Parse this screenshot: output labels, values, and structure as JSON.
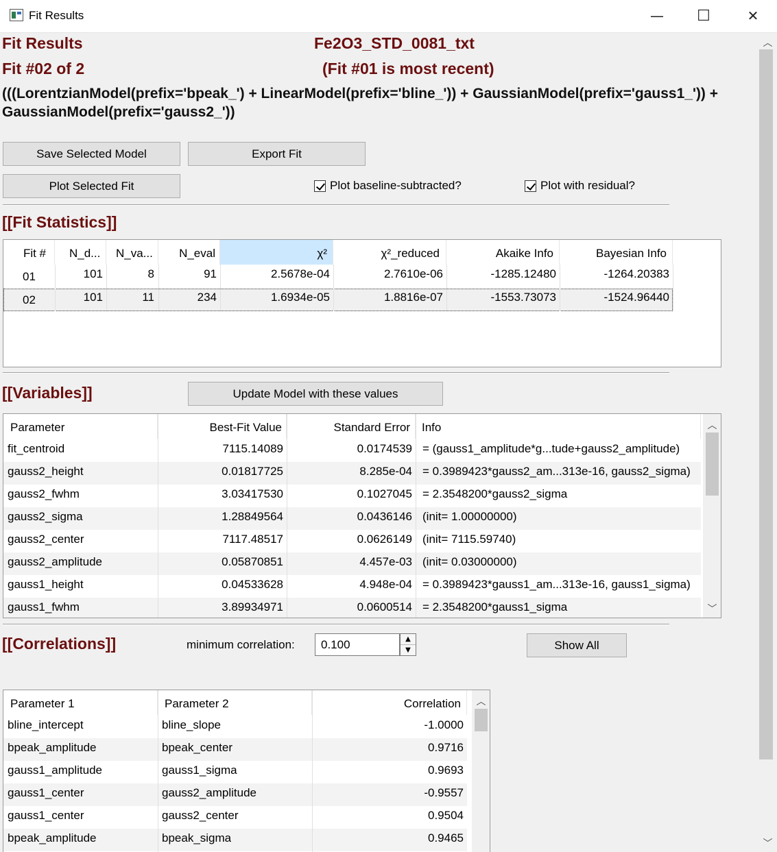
{
  "window": {
    "title": "Fit Results",
    "min_glyph": "—",
    "max_glyph": "☐",
    "close_glyph": "✕"
  },
  "header": {
    "label": "Fit Results",
    "filename": "Fe2O3_STD_0081_txt",
    "fit_index": "Fit #02 of 2",
    "recent_note": "(Fit #01 is most recent)",
    "model_line1": "(((LorentzianModel(prefix='bpeak_') + LinearModel(prefix='bline_')) + GaussianModel(prefix='gauss1_')) +",
    "model_line2": " GaussianModel(prefix='gauss2_'))"
  },
  "buttons": {
    "save_model": "Save Selected Model",
    "export_fit": "Export Fit",
    "plot_fit": "Plot Selected Fit",
    "update_model": "Update Model with these values",
    "show_all": "Show All"
  },
  "checkboxes": {
    "baseline": {
      "label": "Plot baseline-subtracted?",
      "checked": true
    },
    "residual": {
      "label": "Plot with residual?",
      "checked": true
    }
  },
  "stats": {
    "title": "[[Fit Statistics]]",
    "columns": [
      "Fit #",
      "N_d...",
      "N_va...",
      "N_eval",
      "χ²",
      "χ²_reduced",
      "Akaike Info",
      "Bayesian Info"
    ],
    "rows": [
      [
        "01",
        "101",
        "8",
        "91",
        "2.5678e-04",
        "2.7610e-06",
        "-1285.12480",
        "-1264.20383"
      ],
      [
        "02",
        "101",
        "11",
        "234",
        "1.6934e-05",
        "1.8816e-07",
        "-1553.73073",
        "-1524.96440"
      ]
    ]
  },
  "variables": {
    "title": "[[Variables]]",
    "columns": [
      "Parameter",
      "Best-Fit Value",
      "Standard Error",
      "Info"
    ],
    "rows": [
      [
        "fit_centroid",
        "7115.14089",
        "0.0174539",
        "= (gauss1_amplitude*g...tude+gauss2_amplitude)"
      ],
      [
        "gauss2_height",
        "0.01817725",
        "8.285e-04",
        "= 0.3989423*gauss2_am...313e-16, gauss2_sigma)"
      ],
      [
        "gauss2_fwhm",
        "3.03417530",
        "0.1027045",
        "= 2.3548200*gauss2_sigma"
      ],
      [
        "gauss2_sigma",
        "1.28849564",
        "0.0436146",
        "(init= 1.00000000)"
      ],
      [
        "gauss2_center",
        "7117.48517",
        "0.0626149",
        "(init= 7115.59740)"
      ],
      [
        "gauss2_amplitude",
        "0.05870851",
        "4.457e-03",
        "(init= 0.03000000)"
      ],
      [
        "gauss1_height",
        "0.04533628",
        "4.948e-04",
        "= 0.3989423*gauss1_am...313e-16, gauss1_sigma)"
      ],
      [
        "gauss1_fwhm",
        "3.89934971",
        "0.0600514",
        "= 2.3548200*gauss1_sigma"
      ]
    ]
  },
  "correlations": {
    "title": "[[Correlations]]",
    "min_label": "minimum correlation:",
    "min_value": "0.100",
    "columns": [
      "Parameter 1",
      "Parameter 2",
      "Correlation"
    ],
    "rows": [
      [
        "bline_intercept",
        "bline_slope",
        "-1.0000"
      ],
      [
        "bpeak_amplitude",
        "bpeak_center",
        "0.9716"
      ],
      [
        "gauss1_amplitude",
        "gauss1_sigma",
        "0.9693"
      ],
      [
        "gauss1_center",
        "gauss2_amplitude",
        "-0.9557"
      ],
      [
        "gauss1_center",
        "gauss2_center",
        "0.9504"
      ],
      [
        "bpeak_amplitude",
        "bpeak_sigma",
        "0.9465"
      ]
    ]
  }
}
